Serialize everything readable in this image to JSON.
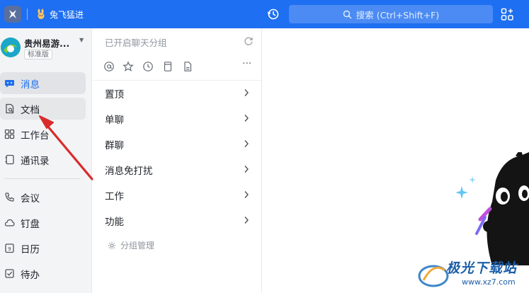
{
  "topbar": {
    "user_name": "兔飞猛进",
    "search_placeholder": "搜索 (Ctrl+Shift+F)",
    "brand_color": "#1e6ff1"
  },
  "org": {
    "name": "贵州易游...",
    "edition": "标准版"
  },
  "nav": {
    "items": [
      {
        "label": "消息",
        "icon": "message-icon"
      },
      {
        "label": "文档",
        "icon": "document-icon"
      },
      {
        "label": "工作台",
        "icon": "workbench-icon"
      },
      {
        "label": "通讯录",
        "icon": "contacts-icon"
      },
      {
        "label": "会议",
        "icon": "meeting-icon"
      },
      {
        "label": "钉盘",
        "icon": "cloud-drive-icon"
      },
      {
        "label": "日历",
        "icon": "calendar-icon"
      },
      {
        "label": "待办",
        "icon": "todo-icon"
      }
    ],
    "active_color": "#1e6ff1"
  },
  "panel": {
    "title": "已开启聊天分组",
    "groups": [
      {
        "label": "置顶"
      },
      {
        "label": "单聊"
      },
      {
        "label": "群聊"
      },
      {
        "label": "消息免打扰"
      },
      {
        "label": "工作"
      },
      {
        "label": "功能"
      }
    ],
    "manage_label": "分组管理",
    "more_label": "···"
  },
  "watermark": {
    "text": "极光下载站",
    "url": "www.xz7.com"
  }
}
